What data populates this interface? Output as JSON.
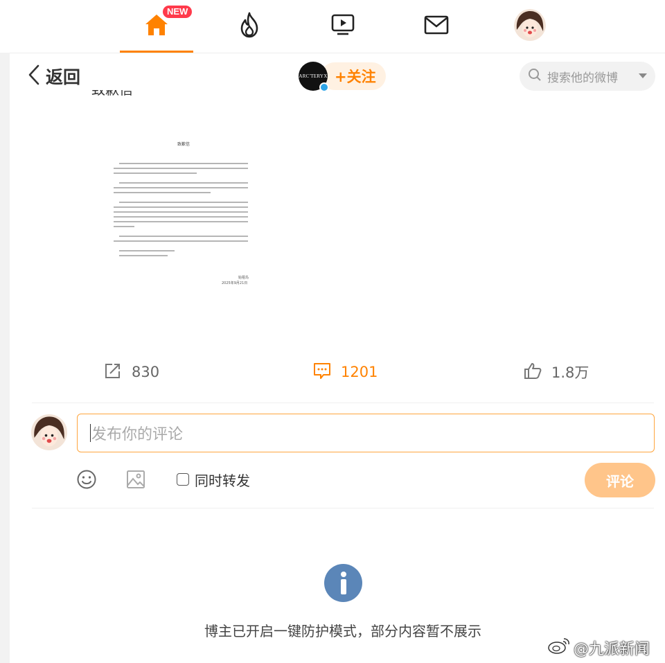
{
  "nav": {
    "home_badge": "NEW",
    "items": [
      "home",
      "hot",
      "video",
      "messages",
      "profile"
    ]
  },
  "header": {
    "back_label": "返回",
    "author_logo": "ARC'TERYX",
    "follow_label": "+关注",
    "search_placeholder": "搜索他的微博"
  },
  "post": {
    "cut_text": "致歉信",
    "document": {
      "title": "致歉信",
      "signature": "始祖鸟",
      "date": "2025年9月21日"
    }
  },
  "actions": {
    "repost_count": "830",
    "comment_count": "1201",
    "like_count": "1.8万"
  },
  "composer": {
    "placeholder": "发布你的评论",
    "repost_label": "同时转发",
    "submit_label": "评论"
  },
  "notice": {
    "text": "博主已开启一键防护模式，部分内容暂不展示"
  },
  "watermark": {
    "text": "@九派新闻"
  },
  "colors": {
    "accent": "#ff8200",
    "follow_bg": "#fff1e2",
    "submit_bg": "#ffc58a",
    "info_icon": "#5b86b8",
    "badge": "#ff3a4b"
  }
}
